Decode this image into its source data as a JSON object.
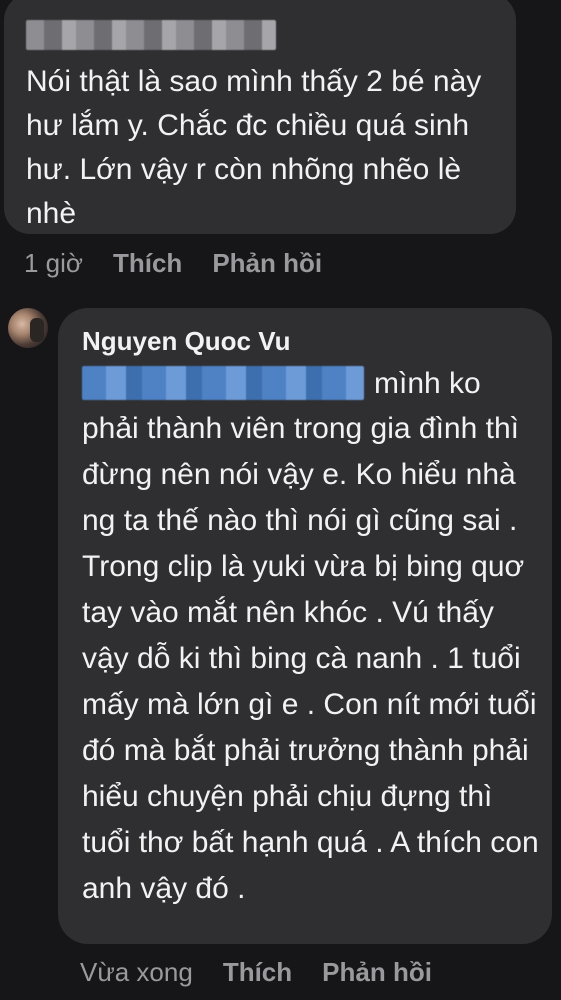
{
  "comment1": {
    "author_redacted": true,
    "text": "Nói thật là sao mình thấy 2 bé này hư lắm y. Chắc đc chiều quá sinh hư. Lớn vậy r còn nhõng nhẽo lè nhè",
    "time": "1 giờ",
    "like_label": "Thích",
    "reply_label": "Phản hồi"
  },
  "comment2": {
    "author": "Nguyen Quoc Vu",
    "mention_redacted": true,
    "text_first_line": "mình ko",
    "text_rest": "phải thành viên trong gia đình thì đừng nên nói vậy e. Ko hiểu nhà ng ta thế nào thì nói gì cũng sai . Trong clip là yuki vừa bị bing quơ tay vào mắt nên khóc . Vú thấy vậy dỗ ki thì bing cà nanh . 1 tuổi mấy mà lớn gì e . Con nít mới tuổi đó mà bắt phải trưởng thành phải hiểu chuyện phải chịu đựng thì tuổi thơ bất hạnh quá . A thích con anh vậy đó .",
    "time": "Vừa xong",
    "like_label": "Thích",
    "reply_label": "Phản hồi"
  }
}
